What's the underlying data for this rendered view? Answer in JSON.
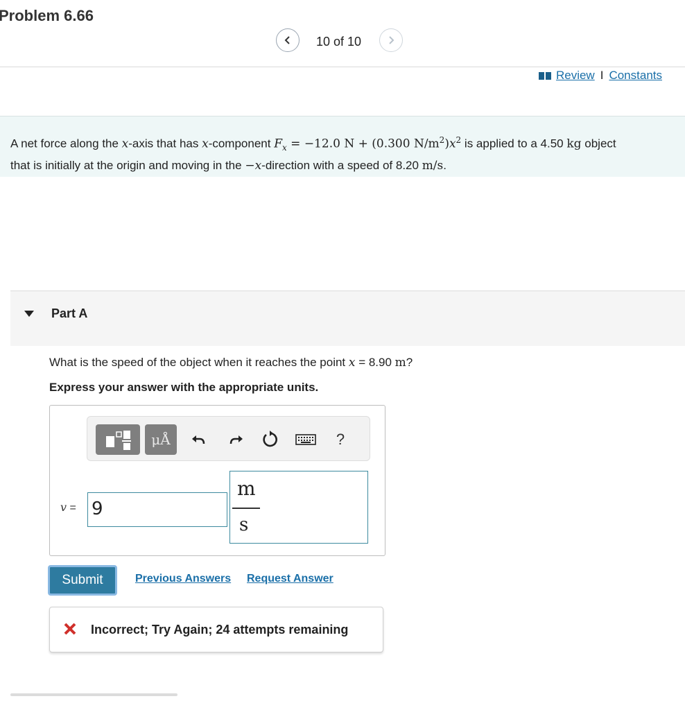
{
  "header": {
    "title": "Problem 6.66",
    "counter": "10 of 10",
    "review_label": "Review",
    "separator": "I",
    "constants_label": "Constants"
  },
  "problem": {
    "t1": "A net force along the ",
    "x": "x",
    "t2": "-axis that has ",
    "t3": "-component ",
    "F": "F",
    "sub": "x",
    "eq": " = −12.0 N + (0.300 N/m",
    "sq": "2",
    "eq2": ")",
    "t4": " is applied to a 4.50 ",
    "kg": "kg",
    "t5": " object",
    "t6": "that is initially at the origin and moving in the ",
    "negx": "−",
    "t7": "-direction with a speed of 8.20 ",
    "speed_unit": "m/s",
    "t8": "."
  },
  "part": {
    "label": "Part A",
    "question_pre": "What is the speed of the object when it reaches the point ",
    "question_var": "x",
    "question_eq": " = 8.90 ",
    "question_unit": "m",
    "question_post": "?",
    "instruction": "Express your answer with the appropriate units."
  },
  "toolbar": {
    "units_tool_label": "μÅ",
    "help_label": "?"
  },
  "answer": {
    "variable": "v",
    "equals": " =",
    "value": "9",
    "unit_numerator": "m",
    "unit_denominator": "s"
  },
  "actions": {
    "submit": "Submit",
    "previous_answers": "Previous Answers",
    "request_answer": "Request Answer"
  },
  "feedback": {
    "message": "Incorrect; Try Again; 24 attempts remaining"
  },
  "colors": {
    "accent": "#2e7ba0",
    "link": "#1a6fa8",
    "error": "#d0302b",
    "problem_bg": "#eef7f7"
  }
}
